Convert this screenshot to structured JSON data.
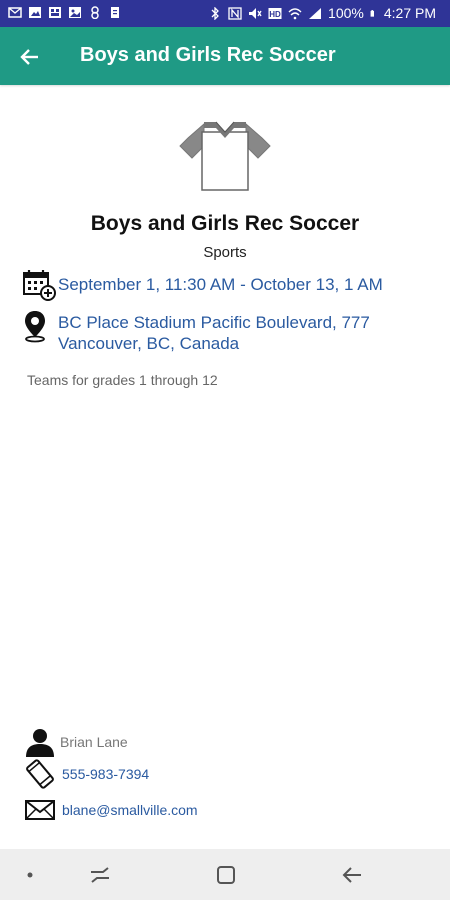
{
  "status_bar": {
    "battery": "100%",
    "time": "4:27 PM",
    "bg_color": "#2f3497",
    "notification_icons": [
      "mail-icon",
      "image-icon",
      "messages-icon",
      "gallery-icon",
      "pill-icon",
      "clipboard-icon"
    ],
    "system_icons": [
      "bluetooth-icon",
      "nfc-icon",
      "mute-icon",
      "hd-icon",
      "wifi-icon",
      "signal-icon",
      "battery-icon"
    ]
  },
  "app_bar": {
    "title": "Boys and Girls Rec Soccer",
    "back_icon": "arrow-left-icon",
    "bg_color": "#1f9a85"
  },
  "event": {
    "image_icon": "jersey-icon",
    "title": "Boys and Girls Rec Soccer",
    "category": "Sports",
    "date_icon": "calendar-add-icon",
    "date_range": "September 1, 11:30 AM - October 13, 1 AM",
    "location_icon": "map-pin-icon",
    "location": "BC Place Stadium Pacific Boulevard, 777 Vancouver, BC, Canada",
    "description": "Teams for grades 1 through 12"
  },
  "contact": {
    "person_icon": "person-icon",
    "name": "Brian Lane",
    "phone_icon": "phone-icon",
    "phone": "555-983-7394",
    "email_icon": "envelope-icon",
    "email": "blane@smallville.com"
  },
  "nav_bar": {
    "items": [
      "dot-icon",
      "recents-icon",
      "home-icon",
      "back-icon"
    ]
  },
  "colors": {
    "link": "#2a5aa0"
  }
}
